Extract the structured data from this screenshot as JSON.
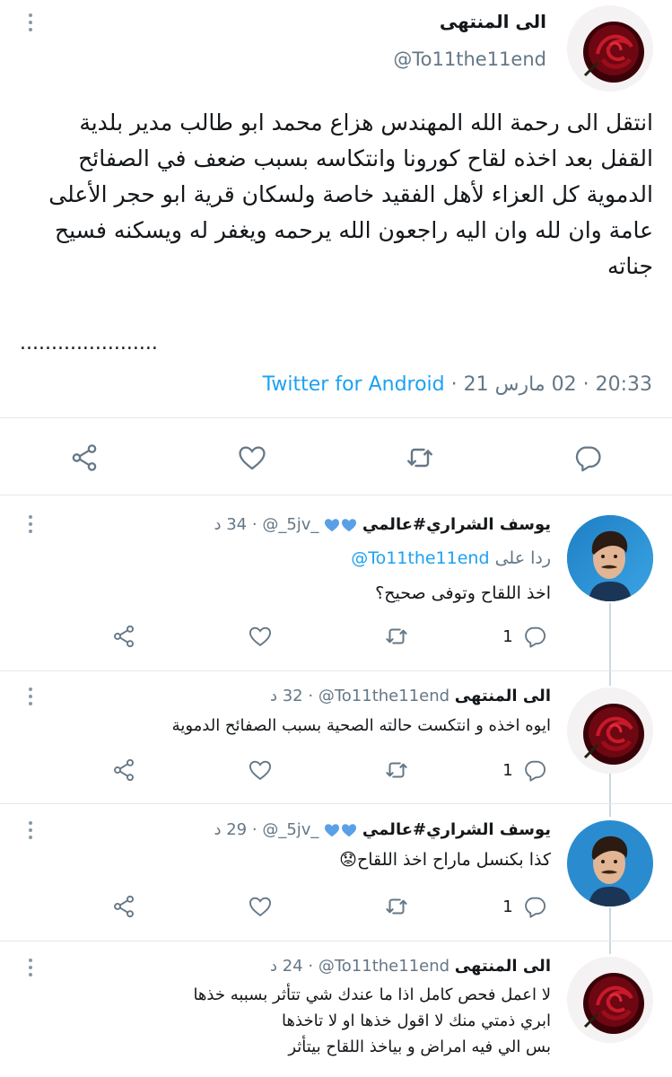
{
  "main_tweet": {
    "display_name": "الى المنتهى",
    "handle": "@To11the11end",
    "text": "انتقل الى رحمة الله المهندس هزاع محمد ابو طالب مدير بلدية القفل بعد اخذه لقاح كورونا وانتكاسه بسبب ضعف في الصفائح الدموية كل العزاء لأهل الفقيد خاصة ولسكان قرية ابو حجر الأعلى عامة وان لله وان اليه راجعون الله يرحمه ويغفر له ويسكنه فسيح جناته",
    "ellipsis": "......................",
    "time": "20:33",
    "date": "02 مارس 21",
    "source": "Twitter for Android",
    "separator": "·"
  },
  "replies": [
    {
      "display_name": "يوسف الشراري#عالمي",
      "handle": "@_5jv_",
      "time_ago": "34 د",
      "replying_prefix": "ردا على",
      "replying_to": "@To11the11end",
      "text": "اخذ اللقاح وتوفى صحيح؟",
      "reply_count": "1",
      "avatar": "man-avatar"
    },
    {
      "display_name": "الى المنتهى",
      "handle": "@To11the11end",
      "time_ago": "32 د",
      "text": "ايوه اخذه و انتكست حالته الصحية بسبب الصفائح الدموية",
      "reply_count": "1",
      "avatar": "rose-avatar"
    },
    {
      "display_name": "يوسف الشراري#عالمي",
      "handle": "@_5jv_",
      "time_ago": "29 د",
      "text": "كذا بكنسل ماراح اخذ اللقاح",
      "emoji": "😟",
      "reply_count": "1",
      "avatar": "man-avatar"
    },
    {
      "display_name": "الى المنتهى",
      "handle": "@To11the11end",
      "time_ago": "24 د",
      "lines": [
        "لا اعمل فحص كامل اذا ما عندك شي تتأثر بسببه خذها",
        "ابري ذمتي منك لا اقول خذها او لا تاخذها",
        "بس الي فيه امراض و بياخذ اللقاح بيتأثر"
      ],
      "avatar": "rose-avatar"
    }
  ],
  "colors": {
    "accent": "#1da1f2",
    "muted": "#657786",
    "heart_blue": "#5aa0e6",
    "icon": "#657786"
  },
  "icons": [
    "share-icon",
    "like-icon",
    "retweet-icon",
    "reply-icon",
    "more-icon",
    "blue-heart-icon"
  ]
}
